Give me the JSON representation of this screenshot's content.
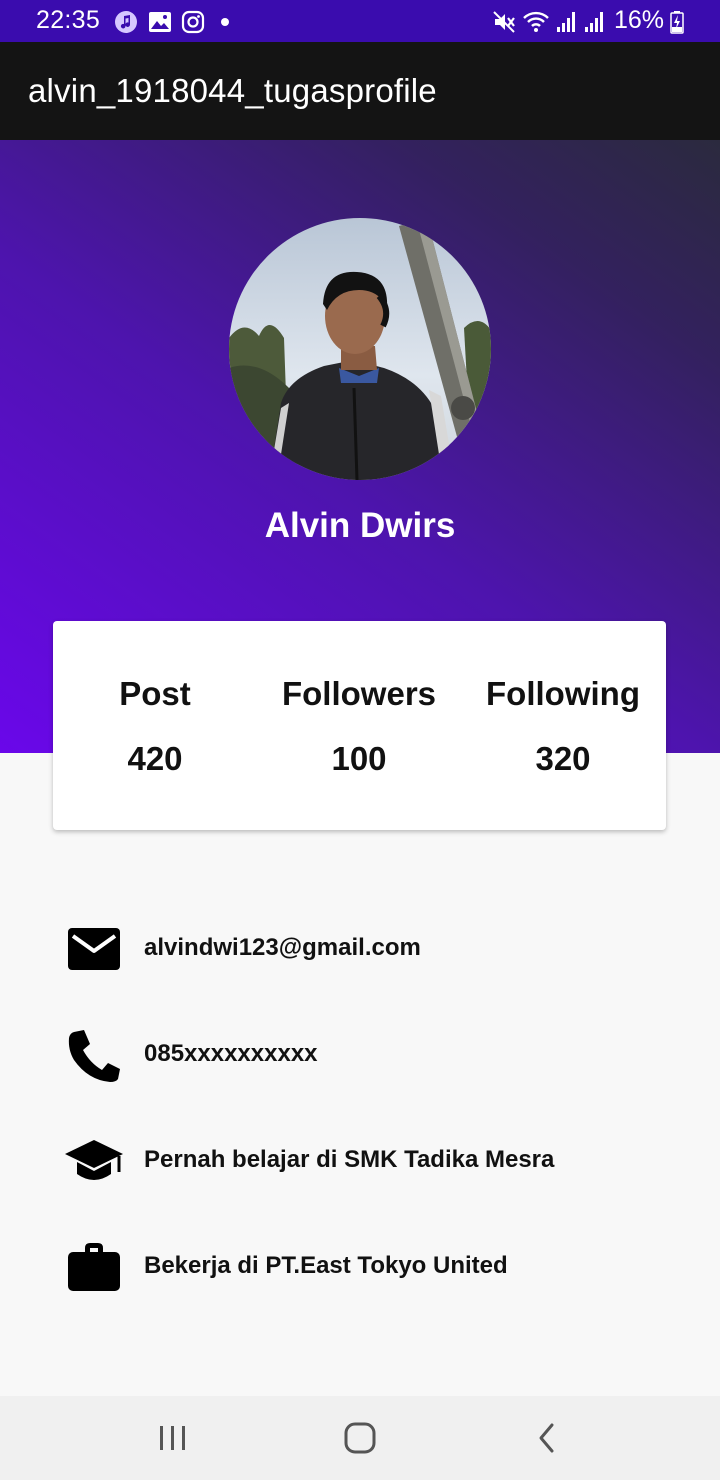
{
  "status_bar": {
    "time": "22:35",
    "battery": "16%",
    "notification_icons": [
      "music-icon",
      "image-icon",
      "instagram-icon",
      "dot-icon"
    ],
    "system_icons": [
      "mute-icon",
      "wifi-icon",
      "signal-icon",
      "signal-icon",
      "battery-charging-icon"
    ]
  },
  "app_bar": {
    "title": "alvin_1918044_tugasprofile"
  },
  "profile": {
    "name": "Alvin Dwirs",
    "avatar": "profile-photo"
  },
  "stats": [
    {
      "label": "Post",
      "value": "420"
    },
    {
      "label": "Followers",
      "value": "100"
    },
    {
      "label": "Following",
      "value": "320"
    }
  ],
  "info": [
    {
      "icon": "email-icon",
      "text": "alvindwi123@gmail.com"
    },
    {
      "icon": "phone-icon",
      "text": "085xxxxxxxxxx"
    },
    {
      "icon": "graduation-cap-icon",
      "text": "Pernah belajar di SMK Tadika Mesra"
    },
    {
      "icon": "briefcase-icon",
      "text": "Bekerja di PT.East Tokyo United"
    }
  ],
  "nav_bar": {
    "buttons": [
      "recent-apps",
      "home",
      "back"
    ]
  },
  "colors": {
    "status_bar": "#3a0cae",
    "app_bar": "#141414",
    "gradient_start": "#6a07ea",
    "gradient_end": "#2b2a3e",
    "background": "#f8f8f8"
  }
}
